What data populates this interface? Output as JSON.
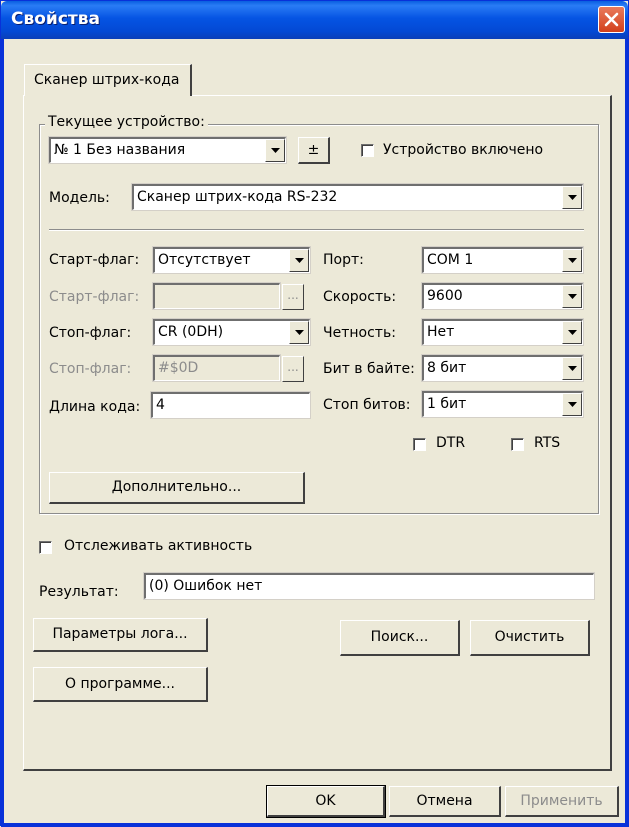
{
  "window": {
    "title": "Свойства"
  },
  "tabs": [
    {
      "label": "Сканер штрих-кода"
    }
  ],
  "device_group": {
    "title": "Текущее устройство:",
    "device_value": "№ 1 Без названия",
    "plusminus_label": "±",
    "enabled_label": "Устройство включено",
    "enabled_checked": false,
    "model_label": "Модель:",
    "model_value": "Сканер штрих-кода RS-232"
  },
  "settings": {
    "start_flag_label": "Старт-флаг:",
    "start_flag_value": "Отсутствует",
    "start_flag2_label": "Старт-флаг:",
    "start_flag2_value": "",
    "stop_flag_label": "Стоп-флаг:",
    "stop_flag_value": "CR (0DH)",
    "stop_flag2_label": "Стоп-флаг:",
    "stop_flag2_value": "#$0D",
    "ellipsis_label": "...",
    "code_length_label": "Длина кода:",
    "code_length_value": "4",
    "port_label": "Порт:",
    "port_value": "COM 1",
    "speed_label": "Скорость:",
    "speed_value": "9600",
    "parity_label": "Четность:",
    "parity_value": "Нет",
    "bits_label": "Бит в байте:",
    "bits_value": "8 бит",
    "stop_bits_label": "Стоп битов:",
    "stop_bits_value": "1 бит",
    "dtr_label": "DTR",
    "dtr_checked": false,
    "rts_label": "RTS",
    "rts_checked": false,
    "advanced_label": "Дополнительно..."
  },
  "monitor": {
    "track_label": "Отслеживать активность",
    "track_checked": false,
    "result_label": "Результат:",
    "result_value": "(0) Ошибок нет"
  },
  "buttons": {
    "log_params": "Параметры лога...",
    "search": "Поиск...",
    "clear": "Очистить",
    "about": "О программе...",
    "ok": "OK",
    "cancel": "Отмена",
    "apply": "Применить"
  }
}
